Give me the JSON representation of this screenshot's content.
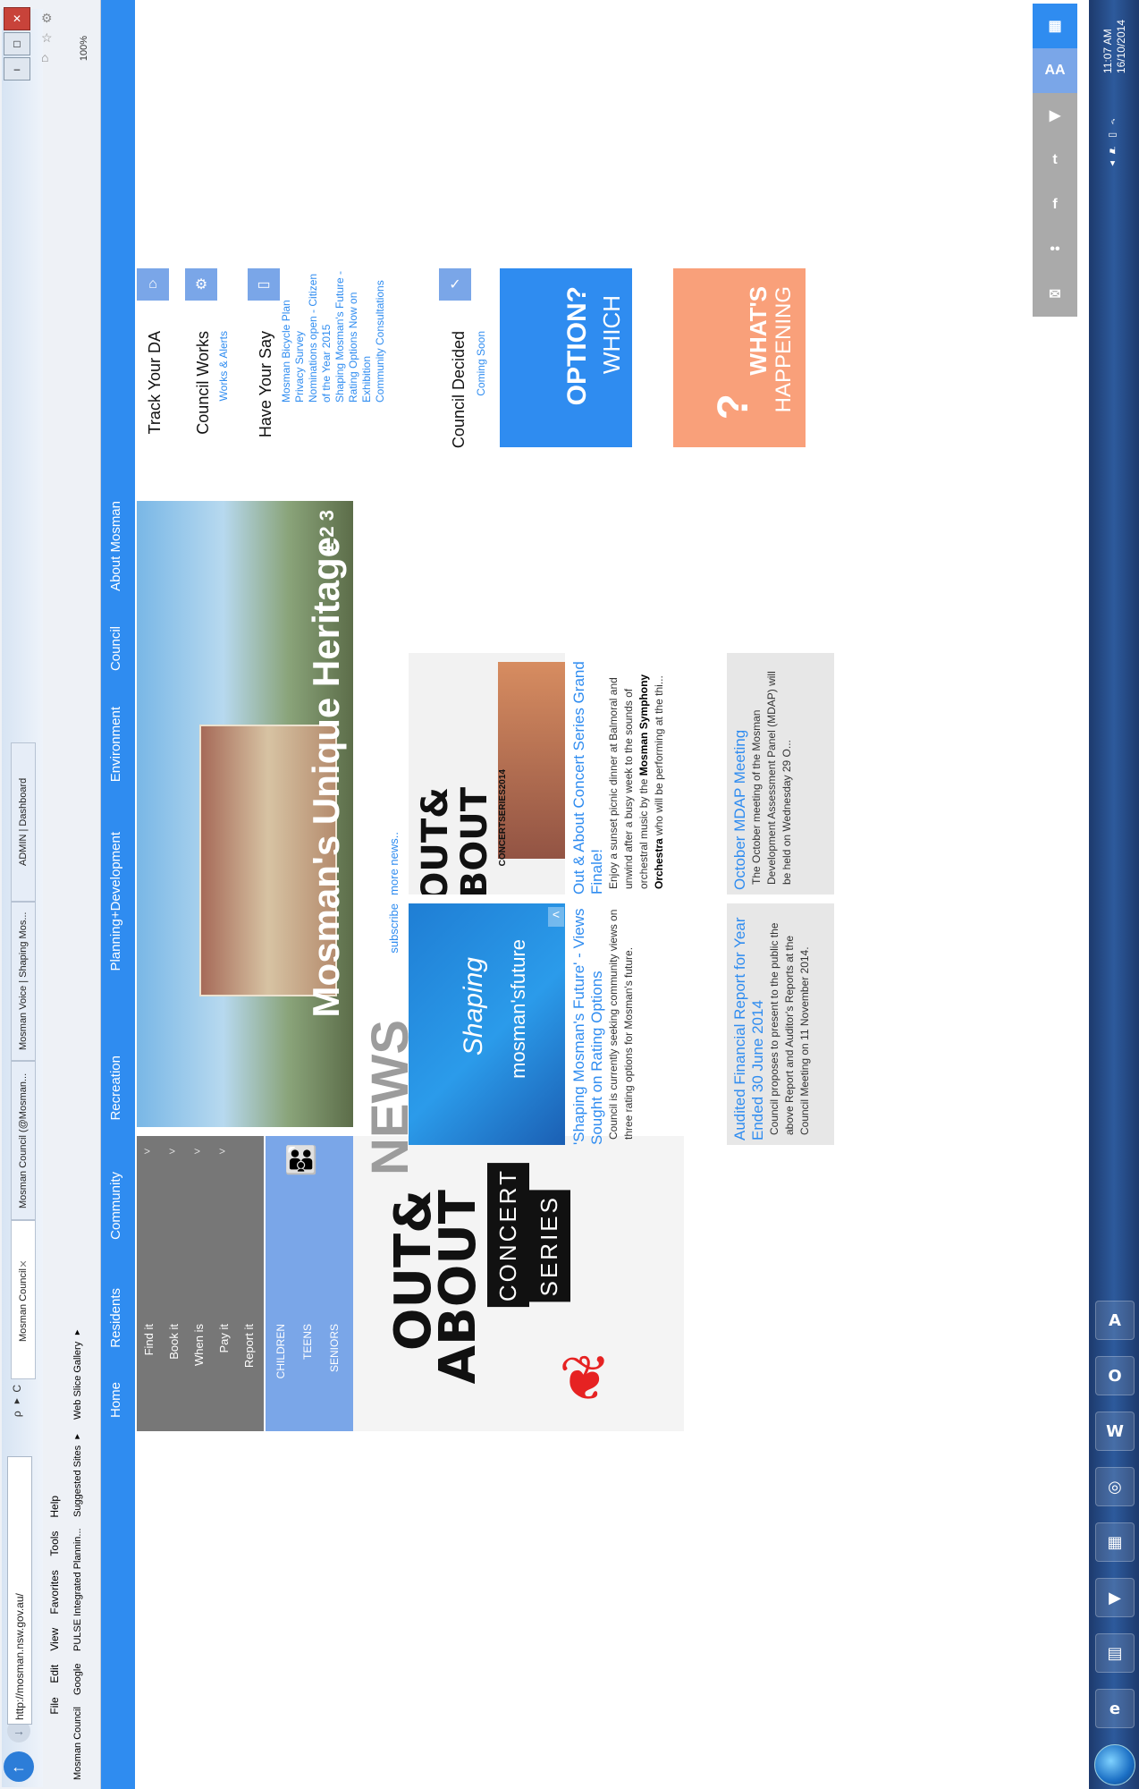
{
  "browser": {
    "url": "http://mosman.nsw.gov.au/",
    "search_hint": "ρ ▾ C",
    "tabs": [
      {
        "label": "Mosman Council",
        "active": true
      },
      {
        "label": "Mosman Council (@Mosman...",
        "active": false
      },
      {
        "label": "Mosman Voice | Shaping Mos...",
        "active": false
      },
      {
        "label": "ADMIN | Dashboard",
        "active": false
      }
    ],
    "menu": [
      "File",
      "Edit",
      "View",
      "Favorites",
      "Tools",
      "Help"
    ],
    "favorites": [
      "Mosman Council",
      "Google",
      "PULSE Integrated Plannin...",
      "Suggested Sites ▾",
      "Web Slice Gallery ▾"
    ],
    "zoom": "100%"
  },
  "taskbar": {
    "time": "11:07 AM",
    "date": "16/10/2014",
    "apps": [
      "ie-icon",
      "file-explorer-icon",
      "media-player-icon",
      "calculator-icon",
      "remote-icon",
      "word-icon",
      "outlook-icon",
      "acrobat-icon"
    ]
  },
  "site": {
    "nav": [
      "Home",
      "Residents",
      "Community",
      "Recreation",
      "Planning+Development",
      "Environment",
      "Council",
      "About Mosman"
    ],
    "social": [
      "calendar-icon",
      "text-size-icon",
      "youtube-icon",
      "twitter-icon",
      "facebook-icon",
      "flickr-icon",
      "email-icon"
    ],
    "quick_menu": [
      "Find it",
      "Book it",
      "When is",
      "Pay it",
      "Report it"
    ],
    "age_menu": [
      "CHILDREN",
      "TEENS",
      "SENIORS"
    ],
    "concert_promo": {
      "line1": "OUT&",
      "line2": "ABOUT",
      "line3": "CONCERT",
      "line4": "SERIES"
    },
    "hero": {
      "title": "Mosman's Unique Heritage",
      "pager": "1 2 3"
    },
    "news": {
      "heading": "NEWS",
      "subscribe": "subscribe",
      "more": "more news..",
      "image1": {
        "l1": "Shaping",
        "l2": "mosman'sfuture"
      },
      "image2": {
        "l1": "OUT&",
        "l2": "ABOUT",
        "l3": "CONCERTSERIES2014"
      },
      "stories": [
        {
          "title": "'Shaping Mosman's Future' - Views Sought on Rating Options",
          "body": "Council is currently seeking community views on three rating options for Mosman's future."
        },
        {
          "title": "Out & About Concert Series Grand Finale!",
          "body_a": "Enjoy a sunset picnic dinner at Balmoral and unwind after a busy week to the sounds of orchestral music by the ",
          "body_b": "Mosman Symphony Orchestra",
          "body_c": " who will be performing at the thi..."
        },
        {
          "title": "Audited Financial Report for Year Ended 30 June 2014",
          "body": "Council proposes to present to the public the above Report and Auditor's Reports at the Council Meeting on 11 November 2014."
        },
        {
          "title": "October MDAP Meeting",
          "body": "The October meeting of the Mosman Development Assessment Panel (MDAP) will be held on Wednesday 29 O..."
        }
      ]
    },
    "right_col": {
      "track": "Track Your DA",
      "works": "Council Works",
      "works_link": "Works & Alerts",
      "say": "Have Your Say",
      "say_links": [
        "Mosman Bicycle Plan",
        "Privacy Survey",
        "Nominations open - Citizen of the Year 2015",
        "Shaping Mosman's Future - Rating Options Now on Exhibition",
        "Community Consultations"
      ],
      "decided": "Council Decided",
      "decided_link": "Coming Soon"
    },
    "which": {
      "l1": "WHICH",
      "l2": "OPTION?"
    },
    "whats": {
      "q": "?",
      "l1": "WHAT'S",
      "l2": "HAPPENING"
    }
  }
}
